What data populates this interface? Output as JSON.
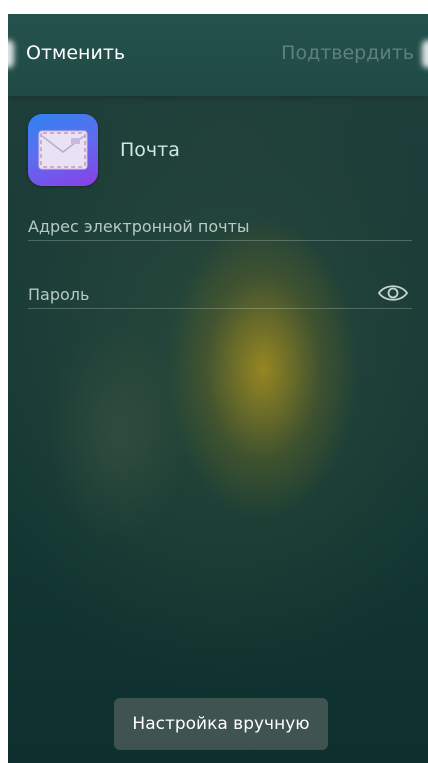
{
  "header": {
    "cancel_label": "Отменить",
    "confirm_label": "Подтвердить"
  },
  "app": {
    "name": "Почта",
    "icon": "mail-envelope-icon"
  },
  "form": {
    "email_placeholder": "Адрес электронной почты",
    "email_value": "",
    "password_placeholder": "Пароль",
    "password_value": "",
    "password_toggle_icon": "eye-icon"
  },
  "footer": {
    "manual_setup_label": "Настройка вручную"
  },
  "colors": {
    "accent_text": "#cfe8e2",
    "topbar": "#25524d",
    "confirm_disabled": "rgba(255,255,255,0.28)"
  }
}
